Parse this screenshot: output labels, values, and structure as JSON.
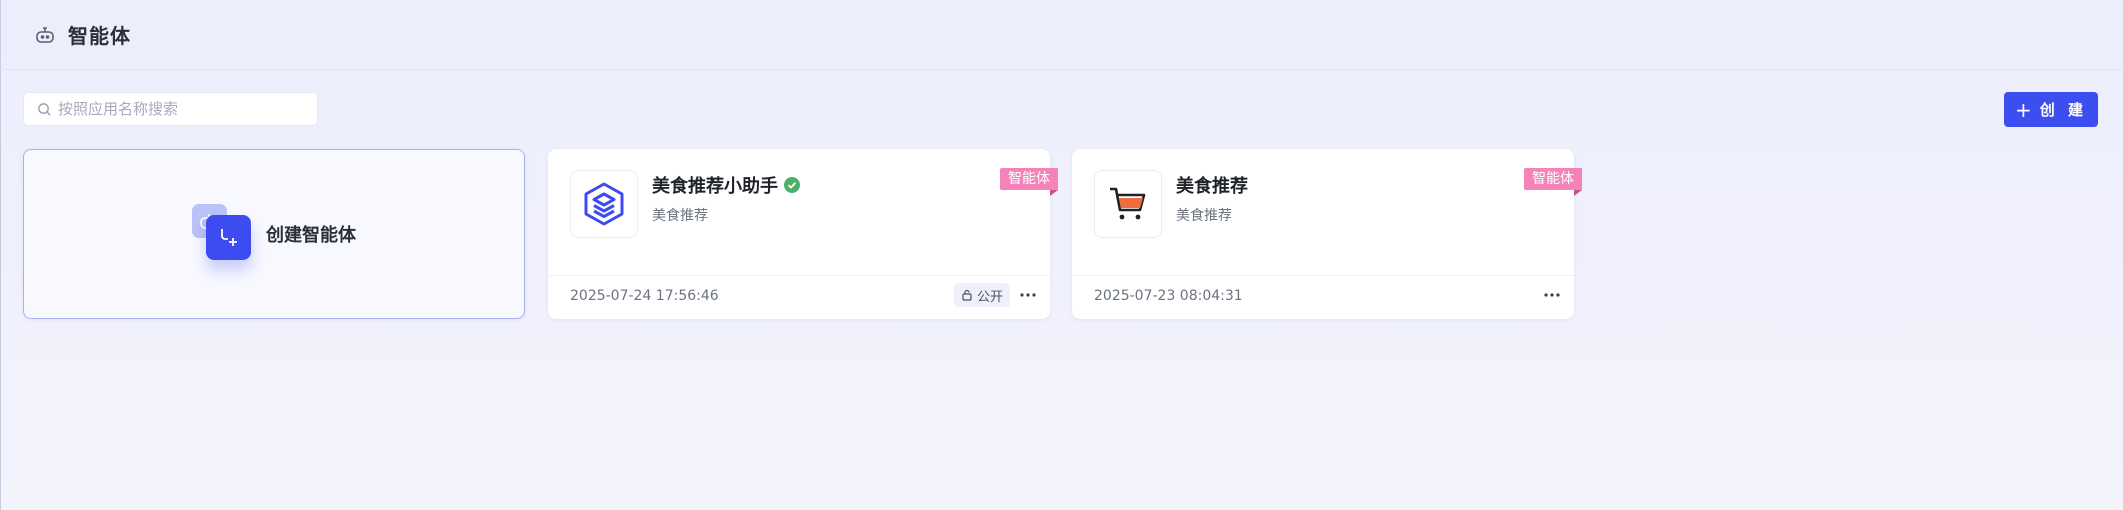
{
  "header": {
    "title": "智能体",
    "icon": "robot-icon"
  },
  "search": {
    "placeholder": "按照应用名称搜索",
    "value": ""
  },
  "toolbar": {
    "create_label": "创 建",
    "create_icon": "plus-icon"
  },
  "new_card": {
    "label": "创建智能体",
    "icon": "create-agent-icon"
  },
  "cards": [
    {
      "name": "美食推荐小助手",
      "description": "美食推荐",
      "tag": "智能体",
      "date": "2025-07-24 17:56:46",
      "visibility": "公开",
      "verified": true,
      "avatar_icon": "stacked-layers-icon"
    },
    {
      "name": "美食推荐",
      "description": "美食推荐",
      "tag": "智能体",
      "date": "2025-07-23 08:04:31",
      "verified": false,
      "avatar_icon": "shopping-cart-icon"
    }
  ],
  "colors": {
    "accent": "#3d4ef0",
    "tag": "#f582b9",
    "verified": "#4caf6a"
  }
}
